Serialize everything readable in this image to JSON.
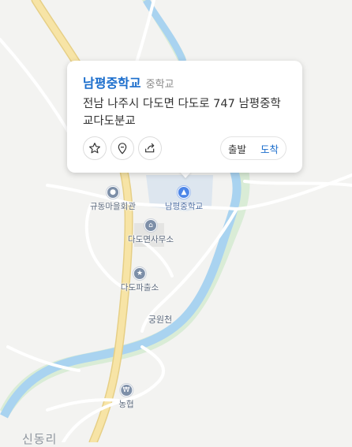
{
  "map": {
    "colors": {
      "background": "#f3f3f1",
      "river": "#a9d3f0",
      "river_bank": "#d9ecd6",
      "main_road": "#f7e4a6",
      "minor_road": "#ffffff",
      "poi_icon": "#7d8fa8",
      "selected_poi": "#4d86e8"
    },
    "pois": [
      {
        "id": "namp",
        "label": "남평중학교",
        "icon": "school-icon",
        "selected": true
      },
      {
        "id": "hall",
        "label": "규동마을회관",
        "icon": "village-hall-icon",
        "selected": false
      },
      {
        "id": "office",
        "label": "다도면사무소",
        "icon": "government-office-icon",
        "selected": false
      },
      {
        "id": "police",
        "label": "다도파출소",
        "icon": "police-icon",
        "selected": false
      },
      {
        "id": "bank",
        "label": "농협",
        "icon": "bank-won-icon",
        "selected": false
      }
    ],
    "stream_label": "궁원천",
    "area_label": "신동리"
  },
  "popup": {
    "name": "남평중학교",
    "category": "중학교",
    "address": "전남 나주시 다도면 다도로 747 남평중학교다도분교",
    "actions": {
      "favorite_icon": "star-icon",
      "location_icon": "map-pin-icon",
      "share_icon": "share-icon",
      "start_label": "출발",
      "end_label": "도착"
    }
  }
}
